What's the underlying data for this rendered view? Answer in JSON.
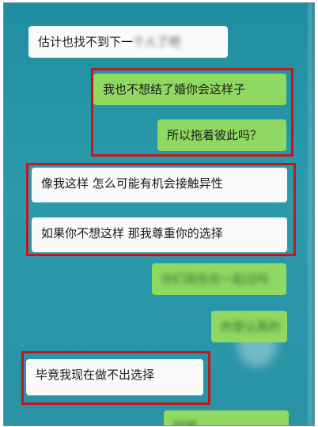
{
  "chat": {
    "messages": [
      {
        "side": "in",
        "text": "估计也找不到下一",
        "trailing_obscured": "个人了吧"
      },
      {
        "side": "out",
        "text": "我也不想结了婚你会这样子"
      },
      {
        "side": "out",
        "text": "所以拖着彼此吗？"
      },
      {
        "side": "in",
        "text": "像我这样 怎么可能有机会接触异性"
      },
      {
        "side": "in",
        "text": "如果你不想这样 那我尊重你的选择"
      },
      {
        "side": "out",
        "text": "你们现在在一起过吗"
      },
      {
        "side": "out",
        "text": "你是认真的"
      },
      {
        "side": "in",
        "text": "毕竟我现在做不出选择"
      },
      {
        "side": "out",
        "text": "好吧"
      }
    ]
  },
  "colors": {
    "background": "#2396a8",
    "incoming_bubble": "#fafafa",
    "outgoing_bubble": "#8fd862",
    "highlight_box": "#c4161c"
  }
}
